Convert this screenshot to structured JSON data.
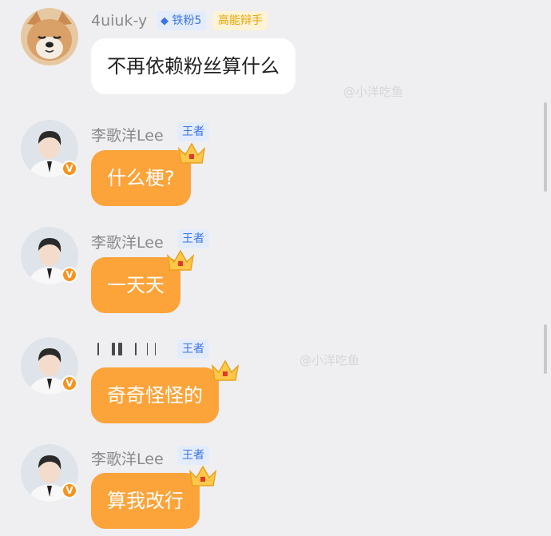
{
  "messages": [
    {
      "username": "4uiuk-y",
      "badge_fan": "铁粉5",
      "badge_title": "高能辩手",
      "text": "不再依赖粉丝算什么",
      "avatar": "shiba-dog-avatar"
    },
    {
      "username": "李歌洋Lee",
      "badge_king": "王者",
      "text": "什么梗?",
      "avatar": "user-photo-avatar"
    },
    {
      "username": "李歌洋Lee",
      "badge_king": "王者",
      "text": "一天天",
      "avatar": "user-photo-avatar"
    },
    {
      "username": "",
      "badge_king": "王者",
      "text": "奇奇怪怪的",
      "avatar": "user-photo-avatar"
    },
    {
      "username": "李歌洋Lee",
      "badge_king": "王者",
      "text": "算我改行",
      "avatar": "user-photo-avatar"
    }
  ],
  "watermark": "@小洋吃鱼",
  "colors": {
    "orange_bubble": "#fca33a",
    "king_badge_text": "#3b73e3",
    "debate_badge_text": "#e7a300",
    "background": "#efeff2"
  },
  "icons": [
    "verified-v-icon",
    "crown-icon",
    "diamond-icon"
  ]
}
